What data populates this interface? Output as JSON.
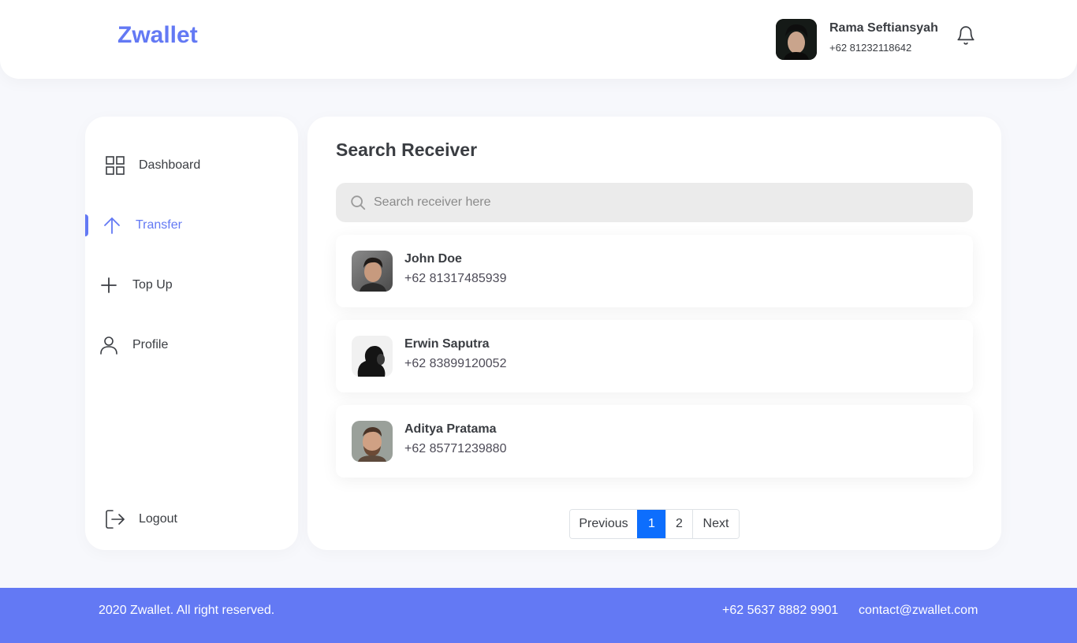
{
  "brand": {
    "name": "Zwallet",
    "color": "#6379F4"
  },
  "user": {
    "name": "Rama Seftiansyah",
    "phone": "+62 81232118642",
    "avatar_icon": "user-avatar",
    "notification_icon": "bell-icon"
  },
  "sidebar": {
    "items": [
      {
        "label": "Dashboard",
        "icon": "grid-icon",
        "active": false
      },
      {
        "label": "Transfer",
        "icon": "arrow-up-icon",
        "active": true
      },
      {
        "label": "Top Up",
        "icon": "plus-icon",
        "active": false
      },
      {
        "label": "Profile",
        "icon": "user-icon",
        "active": false
      }
    ],
    "logout": {
      "label": "Logout",
      "icon": "logout-icon"
    }
  },
  "main": {
    "title": "Search Receiver",
    "search": {
      "placeholder": "Search receiver here",
      "value": ""
    },
    "receivers": [
      {
        "name": "John Doe",
        "phone": "+62 81317485939"
      },
      {
        "name": "Erwin Saputra",
        "phone": "+62 83899120052"
      },
      {
        "name": "Aditya Pratama",
        "phone": "+62 85771239880"
      }
    ],
    "pagination": {
      "previous": "Previous",
      "pages": [
        "1",
        "2"
      ],
      "current": "1",
      "next": "Next"
    }
  },
  "footer": {
    "copyright": "2020 Zwallet. All right reserved.",
    "phone": "+62 5637 8882 9901",
    "email": "contact@zwallet.com"
  },
  "colors": {
    "accent": "#6379F4",
    "page_bg": "#F7F8FC",
    "pagination_active": "#0D6EFD"
  }
}
